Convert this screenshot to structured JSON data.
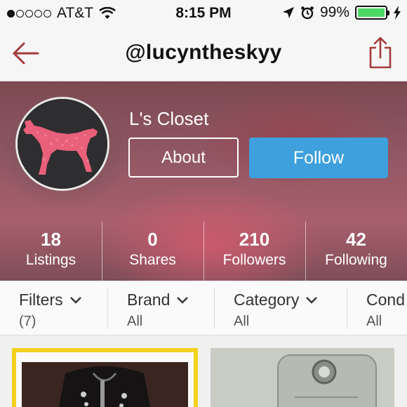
{
  "status_bar": {
    "carrier": "AT&T",
    "time": "8:15 PM",
    "battery": "99%",
    "signal_bars": 1,
    "icons": [
      "wifi-icon",
      "location-arrow-icon",
      "alarm-icon",
      "battery-icon",
      "charging-bolt-icon"
    ]
  },
  "nav": {
    "title": "@lucyntheskyy",
    "back_icon": "back-arrow-icon",
    "share_icon": "share-icon",
    "accent": "#a33a3a"
  },
  "profile": {
    "closet_name": "L's Closet",
    "about_label": "About",
    "follow_label": "Follow",
    "follow_color": "#3ea0dd",
    "stats": [
      {
        "value": "18",
        "label": "Listings"
      },
      {
        "value": "0",
        "label": "Shares"
      },
      {
        "value": "210",
        "label": "Followers"
      },
      {
        "value": "42",
        "label": "Following"
      }
    ]
  },
  "filters": [
    {
      "label": "Filters",
      "value": "(7)"
    },
    {
      "label": "Brand",
      "value": "All"
    },
    {
      "label": "Category",
      "value": "All"
    },
    {
      "label": "Cond",
      "value": "All"
    }
  ]
}
